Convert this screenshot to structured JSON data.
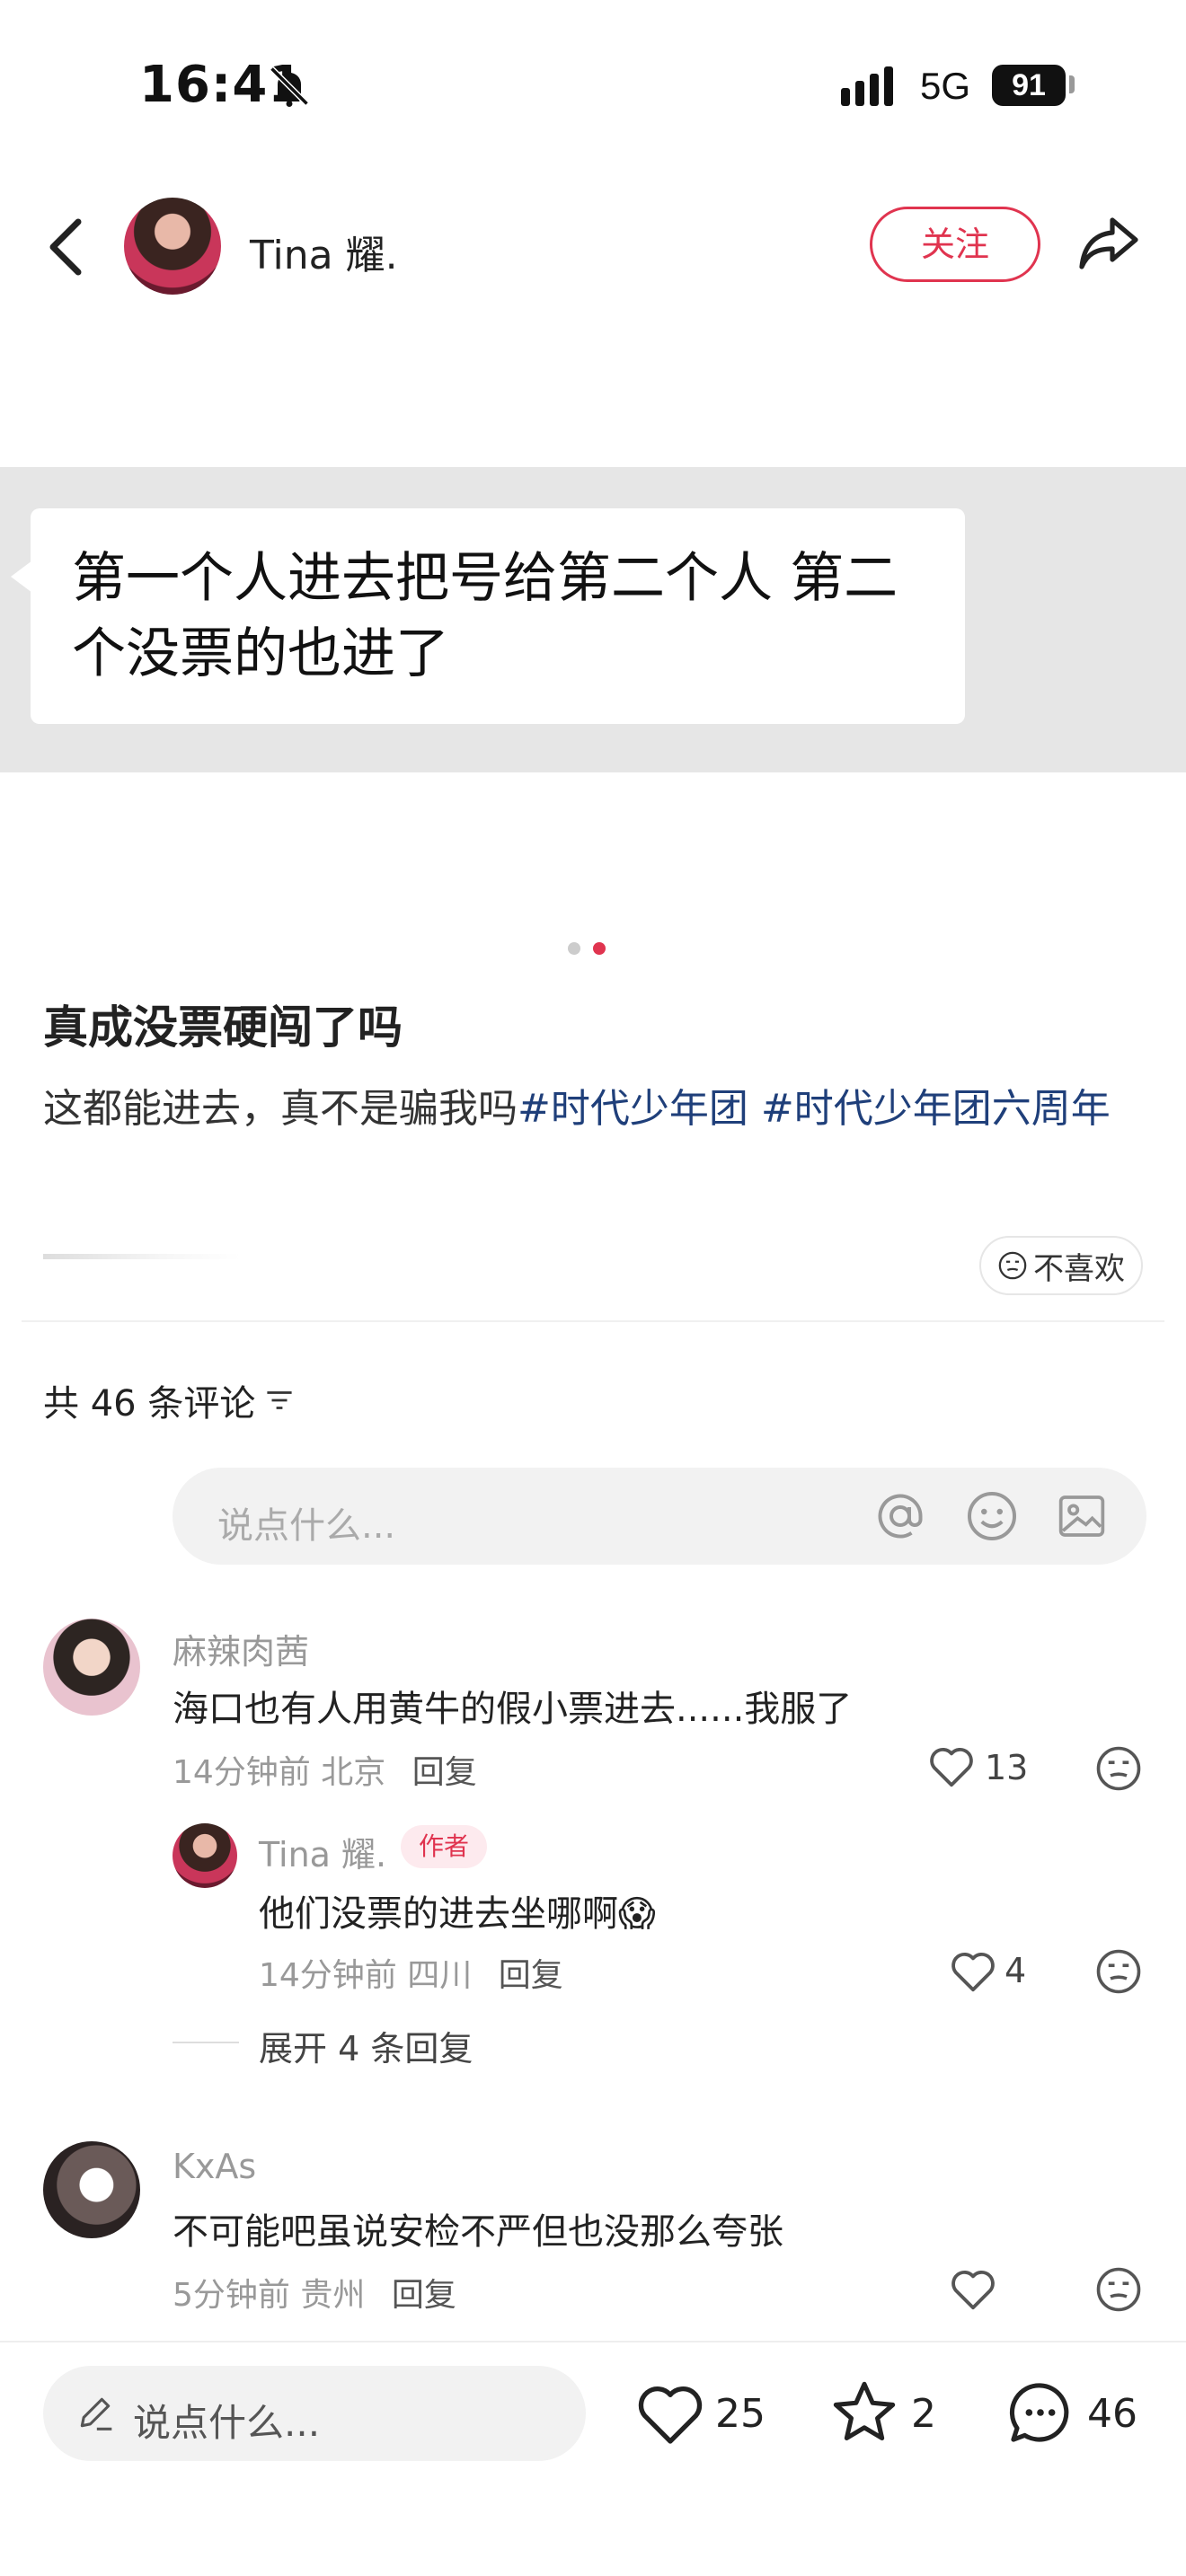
{
  "status_bar": {
    "time": "16:41",
    "network": "5G",
    "battery": "91"
  },
  "header": {
    "author_name": "Tina 耀.",
    "follow_label": "关注"
  },
  "image": {
    "text": "第一个人进去把号给第二个人 第二个没票的也进了"
  },
  "post": {
    "title": "真成没票硬闯了吗",
    "body_text": "这都能进去，真不是骗我吗",
    "hashtags": [
      "#时代少年团",
      " #时代少年团六周年"
    ],
    "dislike_label": "不喜欢"
  },
  "comments_header": {
    "count_label": "共 46 条评论",
    "input_placeholder": "说点什么..."
  },
  "comments": [
    {
      "name": "麻辣肉茜",
      "text": "海口也有人用黄牛的假小票进去......我服了",
      "time": "14分钟前",
      "location": "北京",
      "reply_label": "回复",
      "likes": "13"
    },
    {
      "name": "Tina 耀.",
      "tag": "作者",
      "text": "他们没票的进去坐哪啊😱",
      "time": "14分钟前",
      "location": "四川",
      "reply_label": "回复",
      "likes": "4"
    },
    {
      "name": "KxAs",
      "text": "不可能吧虽说安检不严但也没那么夸张",
      "time": "5分钟前",
      "location": "贵州",
      "reply_label": "回复",
      "likes": ""
    }
  ],
  "expand_replies_label": "展开 4 条回复",
  "bottom_bar": {
    "placeholder": "说点什么...",
    "likes": "25",
    "stars": "2",
    "comments": "46"
  },
  "colors": {
    "accent": "#e0344f",
    "hashtag": "#1f3f7a",
    "muted": "#999999"
  }
}
